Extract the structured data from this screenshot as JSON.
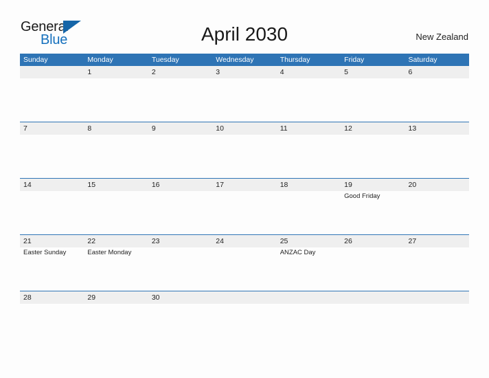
{
  "header": {
    "logo": {
      "text_primary": "General",
      "text_secondary": "Blue",
      "flag_icon": "blue-flag-triangle-icon",
      "primary_color": "#1a1a1a",
      "secondary_color": "#1570bd"
    },
    "title": "April 2030",
    "region": "New Zealand"
  },
  "theme": {
    "header_blue": "#2e74b5",
    "band_gray": "#efefef",
    "page_background": "#fdfdfd",
    "text_color": "#222222"
  },
  "calendar": {
    "month": "April",
    "year": "2030",
    "weekday_headers": [
      "Sunday",
      "Monday",
      "Tuesday",
      "Wednesday",
      "Thursday",
      "Friday",
      "Saturday"
    ],
    "weeks": [
      {
        "days": [
          {
            "num": "",
            "events": []
          },
          {
            "num": "1",
            "events": []
          },
          {
            "num": "2",
            "events": []
          },
          {
            "num": "3",
            "events": []
          },
          {
            "num": "4",
            "events": []
          },
          {
            "num": "5",
            "events": []
          },
          {
            "num": "6",
            "events": []
          }
        ]
      },
      {
        "days": [
          {
            "num": "7",
            "events": []
          },
          {
            "num": "8",
            "events": []
          },
          {
            "num": "9",
            "events": []
          },
          {
            "num": "10",
            "events": []
          },
          {
            "num": "11",
            "events": []
          },
          {
            "num": "12",
            "events": []
          },
          {
            "num": "13",
            "events": []
          }
        ]
      },
      {
        "days": [
          {
            "num": "14",
            "events": []
          },
          {
            "num": "15",
            "events": []
          },
          {
            "num": "16",
            "events": []
          },
          {
            "num": "17",
            "events": []
          },
          {
            "num": "18",
            "events": []
          },
          {
            "num": "19",
            "events": [
              "Good Friday"
            ]
          },
          {
            "num": "20",
            "events": []
          }
        ]
      },
      {
        "days": [
          {
            "num": "21",
            "events": [
              "Easter Sunday"
            ]
          },
          {
            "num": "22",
            "events": [
              "Easter Monday"
            ]
          },
          {
            "num": "23",
            "events": []
          },
          {
            "num": "24",
            "events": []
          },
          {
            "num": "25",
            "events": [
              "ANZAC Day"
            ]
          },
          {
            "num": "26",
            "events": []
          },
          {
            "num": "27",
            "events": []
          }
        ]
      },
      {
        "days": [
          {
            "num": "28",
            "events": []
          },
          {
            "num": "29",
            "events": []
          },
          {
            "num": "30",
            "events": []
          },
          {
            "num": "",
            "events": []
          },
          {
            "num": "",
            "events": []
          },
          {
            "num": "",
            "events": []
          },
          {
            "num": "",
            "events": []
          }
        ]
      }
    ]
  }
}
